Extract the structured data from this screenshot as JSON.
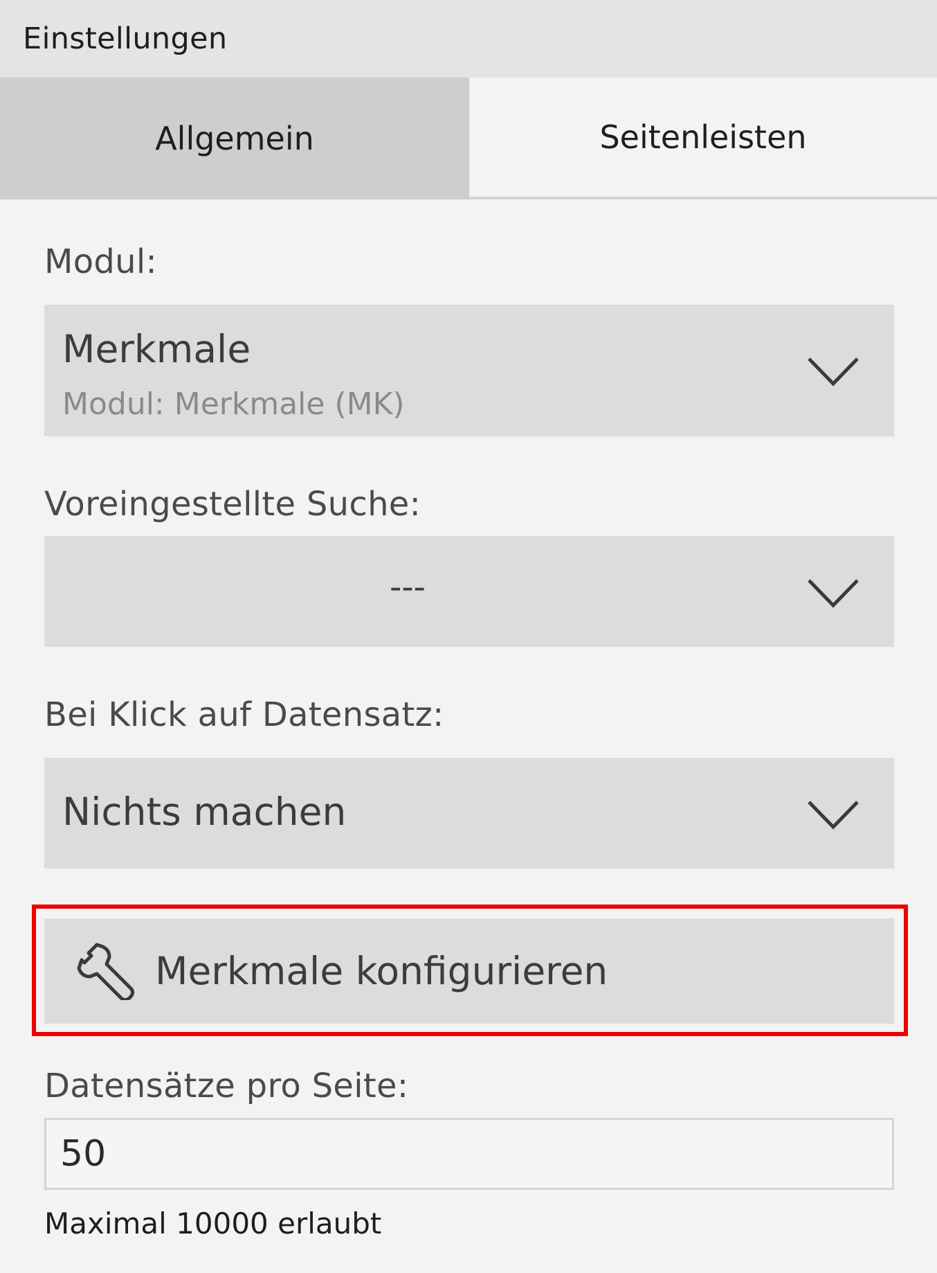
{
  "window": {
    "title": "Einstellungen"
  },
  "tabs": [
    {
      "label": "Allgemein",
      "active": true
    },
    {
      "label": "Seitenleisten",
      "active": false
    }
  ],
  "module": {
    "label": "Modul:",
    "value": "Merkmale",
    "subtitle": "Modul: Merkmale (MK)"
  },
  "preset_search": {
    "label": "Voreingestellte Suche:",
    "value": "---"
  },
  "on_record_click": {
    "label": "Bei Klick auf Datensatz:",
    "value": "Nichts machen"
  },
  "configure_button": {
    "label": "Merkmale konfigurieren",
    "icon": "wrench-icon",
    "highlight_color": "#ee0000"
  },
  "records_per_page": {
    "label": "Datensätze pro Seite:",
    "value": "50",
    "hint": "Maximal 10000 erlaubt"
  },
  "colors": {
    "background": "#f3f3f3",
    "titlebar": "#e4e4e4",
    "active_tab": "#cecece",
    "field": "#dcdcdc"
  }
}
